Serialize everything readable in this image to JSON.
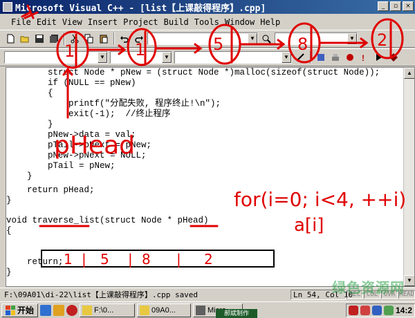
{
  "window": {
    "title": "Microsoft Visual C++ - [list【上课敲得程序】.cpp]",
    "title_display": "Microsoft Visual C++ - [list【上课敲得程序】.cpp]",
    "minimize": "_",
    "restore": "▫",
    "close": "×"
  },
  "menu": [
    "File",
    "Edit",
    "View",
    "Insert",
    "Project",
    "Build",
    "Tools",
    "Window",
    "Help"
  ],
  "toolbar": {
    "icons": [
      "new-file-icon",
      "open-folder-icon",
      "save-icon",
      "save-all-icon",
      "cut-icon",
      "copy-icon",
      "paste-icon",
      "undo-icon",
      "redo-icon"
    ],
    "build_icons": [
      "compile-icon",
      "build-icon",
      "stop-build-icon",
      "run-icon",
      "debug-icon",
      "breakpoint-icon"
    ]
  },
  "editor": {
    "lines": [
      {
        "text": "        struct Node * pNew = (struct Node *)malloc(sizeof(struct Node));"
      },
      {
        "text": "        if (NULL == pNew)"
      },
      {
        "text": "        {"
      },
      {
        "text": "            printf(\"分配失败, 程序终止!\\n\");"
      },
      {
        "text": "            exit(-1);  //终止程序"
      },
      {
        "text": "        }"
      },
      {
        "text": "        pNew->data = val;"
      },
      {
        "text": "        pTail->pNext = pNew;"
      },
      {
        "text": "        pNew->pNext = NULL;"
      },
      {
        "text": "        pTail = pNew;"
      },
      {
        "text": "    }"
      },
      {
        "text": ""
      },
      {
        "text": "    return pHead;"
      },
      {
        "text": "}"
      },
      {
        "text": ""
      },
      {
        "text": "void traverse_list(struct Node * pHead)"
      },
      {
        "text": "{"
      },
      {
        "text": ""
      },
      {
        "text": ""
      },
      {
        "text": "    return;"
      },
      {
        "text": "}"
      }
    ]
  },
  "annotations": {
    "top_numbers": [
      "1",
      "1",
      "5",
      "8",
      "2"
    ],
    "phead_label": "pHead",
    "loop_text": "for(i=0; i<4, ++i)",
    "array_text": "a[i]",
    "box_numbers": [
      "1",
      "5",
      "8",
      "2"
    ],
    "box_separator": "|"
  },
  "status": {
    "message": "F:\\09A01\\di-22\\list【上课敲得程序】.cpp saved",
    "position": "Ln 54, Col 10",
    "indicators": [
      "REC",
      "COL",
      "OVR",
      "READ"
    ]
  },
  "taskbar": {
    "start": "开始",
    "tasks": [
      {
        "label": "F:\\0..."
      },
      {
        "label": "09A0..."
      },
      {
        "label": "Micro..."
      }
    ],
    "clock": "14:2",
    "watermark": "绿色资源网",
    "bottom_label": "郝斌制作"
  },
  "colors": {
    "title_start": "#0a246a",
    "title_end": "#3a6ea5",
    "keyword": "#0000ff",
    "comment": "#008000",
    "annotation": "#e00000"
  }
}
